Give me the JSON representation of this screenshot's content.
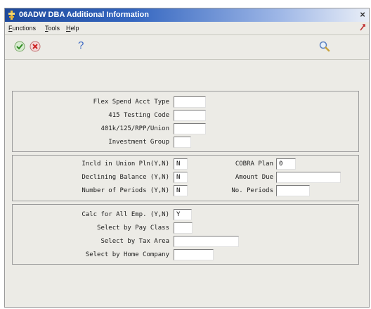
{
  "window": {
    "title": "06ADW  DBA Additional Information",
    "close_label": "×"
  },
  "menu": {
    "items": [
      {
        "hotkey": "F",
        "rest": "unctions"
      },
      {
        "hotkey": "T",
        "rest": "ools"
      },
      {
        "hotkey": "H",
        "rest": "elp"
      }
    ]
  },
  "toolbar": {
    "ok_icon": "check-icon",
    "cancel_icon": "cancel-icon",
    "help_label": "?",
    "search_icon": "magnifier-icon"
  },
  "group1": {
    "flex_spend_label": "Flex Spend Acct Type",
    "flex_spend_value": "",
    "testing_code_label": "415 Testing Code",
    "testing_code_value": "",
    "union_label": "401k/125/RPP/Union",
    "union_value": "",
    "investment_group_label": "Investment Group",
    "investment_group_value": ""
  },
  "group2": {
    "incld_union_label": "Incld in Union Pln(Y,N)",
    "incld_union_value": "N",
    "declining_balance_label": "Declining Balance (Y,N)",
    "declining_balance_value": "N",
    "number_periods_label": "Number of Periods (Y,N)",
    "number_periods_value": "N",
    "cobra_plan_label": "COBRA Plan",
    "cobra_plan_value": "0",
    "amount_due_label": "Amount Due",
    "amount_due_value": "",
    "no_periods_label": "No. Periods",
    "no_periods_value": ""
  },
  "group3": {
    "calc_all_label": "Calc for All Emp. (Y,N)",
    "calc_all_value": "Y",
    "pay_class_label": "Select by Pay Class",
    "pay_class_value": "",
    "tax_area_label": "Select by Tax Area",
    "tax_area_value": "",
    "home_company_label": "Select by Home Company",
    "home_company_value": ""
  }
}
